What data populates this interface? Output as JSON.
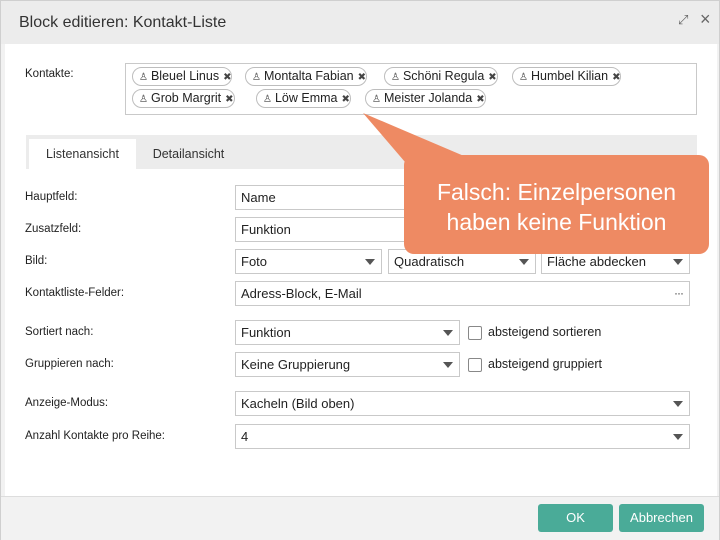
{
  "window": {
    "title": "Block editieren: Kontakt-Liste"
  },
  "contacts": {
    "label": "Kontakte:",
    "items": [
      "Bleuel Linus",
      "Montalta Fabian",
      "Schöni Regula",
      "Humbel Kilian",
      "Grob Margrit",
      "Löw Emma",
      "Meister Jolanda"
    ]
  },
  "tabs": {
    "list_view": "Listenansicht",
    "detail_view": "Detailansicht"
  },
  "form": {
    "hauptfeld_label": "Hauptfeld:",
    "hauptfeld_value": "Name",
    "zusatzfeld_label": "Zusatzfeld:",
    "zusatzfeld_value": "Funktion",
    "bild_label": "Bild:",
    "bild_value": "Foto",
    "bild_format": "Quadratisch",
    "bild_mode": "Fläche abdecken",
    "kontaktliste_label": "Kontaktliste-Felder:",
    "kontaktliste_value": "Adress-Block, E-Mail",
    "sortiert_label": "Sortiert nach:",
    "sortiert_value": "Funktion",
    "sortiert_desc_label": "absteigend sortieren",
    "gruppieren_label": "Gruppieren nach:",
    "gruppieren_value": "Keine Gruppierung",
    "gruppieren_desc_label": "absteigend gruppiert",
    "anzeige_label": "Anzeige-Modus:",
    "anzeige_value": "Kacheln (Bild oben)",
    "anzahl_label": "Anzahl Kontakte pro Reihe:",
    "anzahl_value": "4"
  },
  "footer": {
    "ok_label": "OK",
    "cancel_label": "Abbrechen"
  },
  "annotation": {
    "line1": "Falsch: Einzelpersonen",
    "line2": "haben keine Funktion"
  },
  "colors": {
    "button": "#4aab98",
    "callout": "#ee8a63"
  }
}
